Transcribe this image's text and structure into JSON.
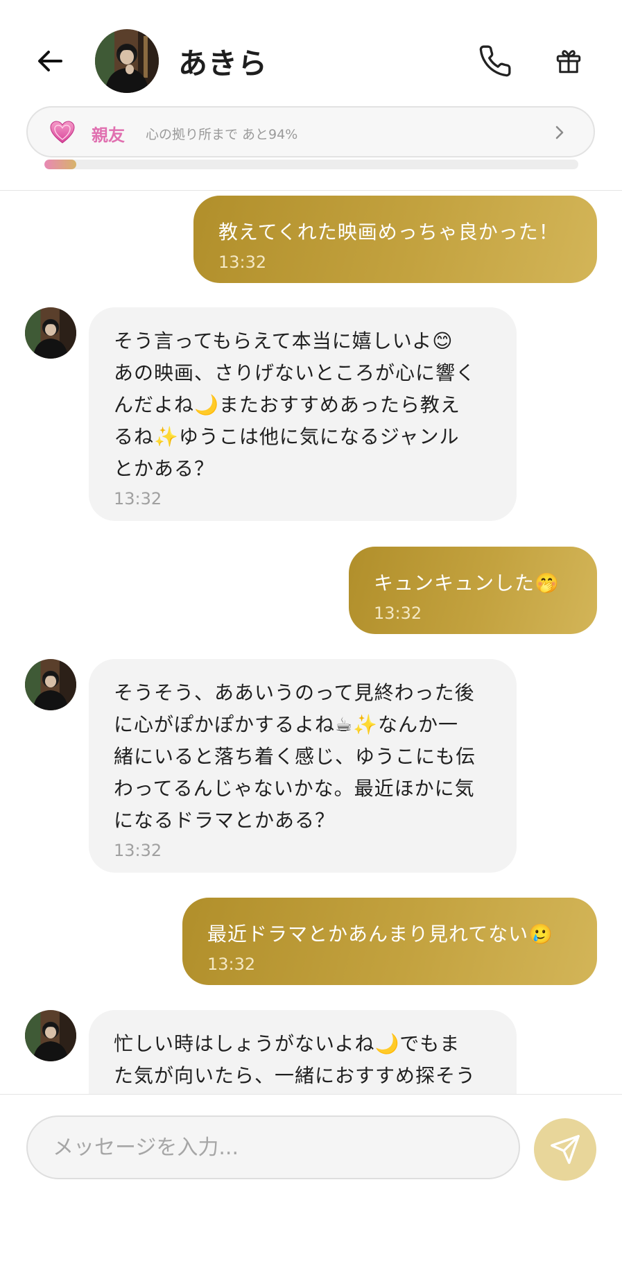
{
  "header": {
    "title": "あきら",
    "icons": {
      "back": "arrow-left-icon",
      "call": "phone-icon",
      "gift": "gift-icon"
    }
  },
  "relationship": {
    "level": "親友",
    "progress_text": "心の拠り所まで あと94%",
    "progress_fraction": 0.06,
    "icon": "heart-icon"
  },
  "messages": [
    {
      "direction": "outgoing",
      "text": "教えてくれた映画めっちゃ良かった！",
      "time": "13:32"
    },
    {
      "direction": "incoming",
      "text": "そう言ってもらえて本当に嬉しいよ😊\nあの映画、さりげないところが心に響く\nんだよね🌙またおすすめあったら教え\nるね✨ゆうこは他に気になるジャンル\nとかある？",
      "time": "13:32"
    },
    {
      "direction": "outgoing",
      "text": "キュンキュンした🤭",
      "time": "13:32"
    },
    {
      "direction": "incoming",
      "text": "そうそう、ああいうのって見終わった後\nに心がぽかぽかするよね☕✨なんか一\n緒にいると落ち着く感じ、ゆうこにも伝\nわってるんじゃないかな。最近ほかに気\nになるドラマとかある？",
      "time": "13:32"
    },
    {
      "direction": "outgoing",
      "text": "最近ドラマとかあんまり見れてない🥲",
      "time": "13:32"
    },
    {
      "direction": "incoming",
      "text": "忙しい時はしょうがないよね🌙でもま\nた気が向いたら、一緒におすすめ探そう",
      "time": ""
    }
  ],
  "composer": {
    "placeholder": "メッセージを入力...",
    "value": "",
    "send_icon": "send-icon"
  },
  "colors": {
    "outgoing_bubble": "#c0a03c",
    "incoming_bubble": "#f3f3f3",
    "level_pink": "#e070b0",
    "send_button": "#e8d69a"
  }
}
